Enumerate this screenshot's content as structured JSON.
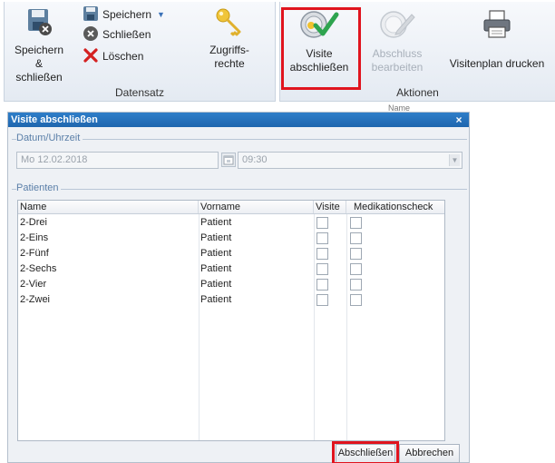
{
  "ribbon": {
    "datensatz": {
      "label": "Datensatz",
      "save_close": "Speichern\n& schließen",
      "save_close_l1": "Speichern",
      "save_close_l2": "& schließen",
      "save": "Speichern",
      "close": "Schließen",
      "delete": "Löschen",
      "access_l1": "Zugriffs-",
      "access_l2": "rechte"
    },
    "aktionen": {
      "label": "Aktionen",
      "visit_close_l1": "Visite",
      "visit_close_l2": "abschließen",
      "edit_close_l1": "Abschluss",
      "edit_close_l2": "bearbeiten",
      "print_plan": "Visitenplan drucken"
    }
  },
  "background_text": "Name",
  "dialog": {
    "title": "Visite abschließen",
    "close_glyph": "×",
    "datetime_legend": "Datum/Uhrzeit",
    "date_value": "Mo 12.02.2018",
    "time_value": "09:30",
    "patients_legend": "Patienten",
    "columns": [
      "Name",
      "Vorname",
      "Visite",
      "Medikationscheck"
    ],
    "rows": [
      {
        "name": "2-Drei",
        "vorname": "Patient",
        "visite": false,
        "medikation": false
      },
      {
        "name": "2-Eins",
        "vorname": "Patient",
        "visite": false,
        "medikation": false
      },
      {
        "name": "2-Fünf",
        "vorname": "Patient",
        "visite": false,
        "medikation": false
      },
      {
        "name": "2-Sechs",
        "vorname": "Patient",
        "visite": false,
        "medikation": false
      },
      {
        "name": "2-Vier",
        "vorname": "Patient",
        "visite": false,
        "medikation": false
      },
      {
        "name": "2-Zwei",
        "vorname": "Patient",
        "visite": false,
        "medikation": false
      }
    ],
    "confirm_label": "Abschließen",
    "cancel_label": "Abbrechen"
  },
  "colors": {
    "highlight": "#e0141e",
    "titlebar": "#2470bb",
    "accent_green": "#2ea44f",
    "delete_red": "#d42020"
  },
  "icons": [
    "save-disk-icon",
    "save-close-icon",
    "close-circle-icon",
    "delete-x-icon",
    "key-icon",
    "visit-check-icon",
    "edit-close-icon",
    "printer-icon",
    "calendar-icon",
    "dropdown-arrow-icon"
  ]
}
